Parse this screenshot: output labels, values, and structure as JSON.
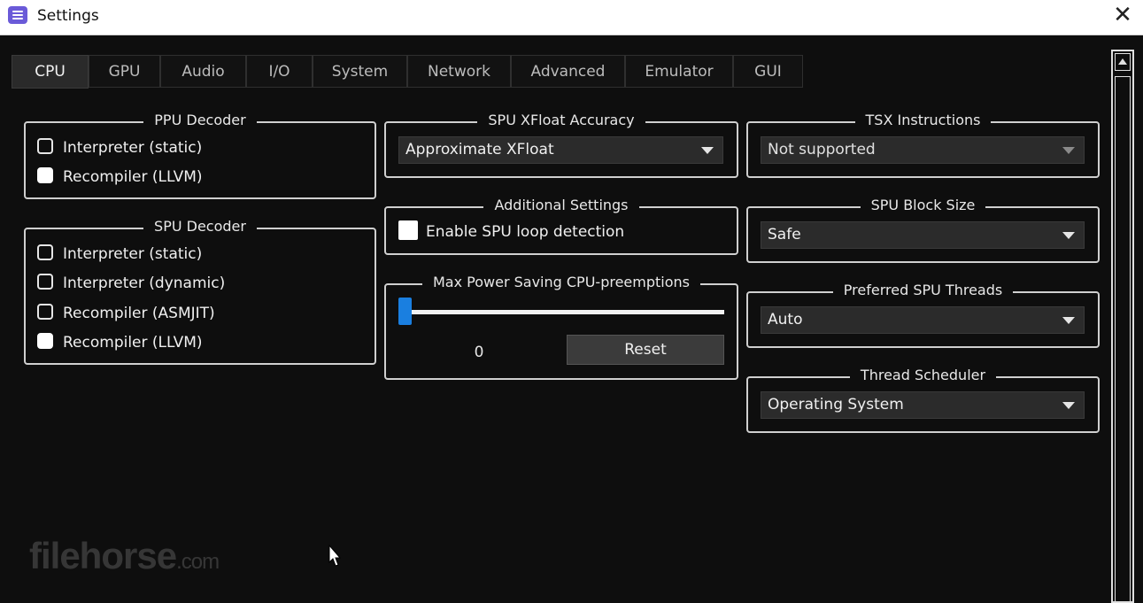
{
  "window": {
    "title": "Settings"
  },
  "tabs": [
    "CPU",
    "GPU",
    "Audio",
    "I/O",
    "System",
    "Network",
    "Advanced",
    "Emulator",
    "GUI"
  ],
  "active_tab": "CPU",
  "ppu_decoder": {
    "title": "PPU Decoder",
    "options": [
      "Interpreter (static)",
      "Recompiler (LLVM)"
    ],
    "selected": "Recompiler (LLVM)"
  },
  "spu_decoder": {
    "title": "SPU Decoder",
    "options": [
      "Interpreter (static)",
      "Interpreter (dynamic)",
      "Recompiler (ASMJIT)",
      "Recompiler (LLVM)"
    ],
    "selected": "Recompiler (LLVM)"
  },
  "spu_xfloat": {
    "title": "SPU XFloat Accuracy",
    "value": "Approximate XFloat"
  },
  "additional_settings": {
    "title": "Additional Settings",
    "checkbox_label": "Enable SPU loop detection",
    "checked": false
  },
  "power_saving": {
    "title": "Max Power Saving CPU-preemptions",
    "value": "0",
    "reset_label": "Reset"
  },
  "tsx": {
    "title": "TSX Instructions",
    "value": "Not supported"
  },
  "spu_block_size": {
    "title": "SPU Block Size",
    "value": "Safe"
  },
  "preferred_spu_threads": {
    "title": "Preferred SPU Threads",
    "value": "Auto"
  },
  "thread_scheduler": {
    "title": "Thread Scheduler",
    "value": "Operating System"
  },
  "watermark": {
    "brand": "filehorse",
    "suffix": ".com"
  },
  "colors": {
    "accent": "#1a7fe0",
    "background": "#0e0e0e",
    "app_icon": "#6a5ad8"
  }
}
